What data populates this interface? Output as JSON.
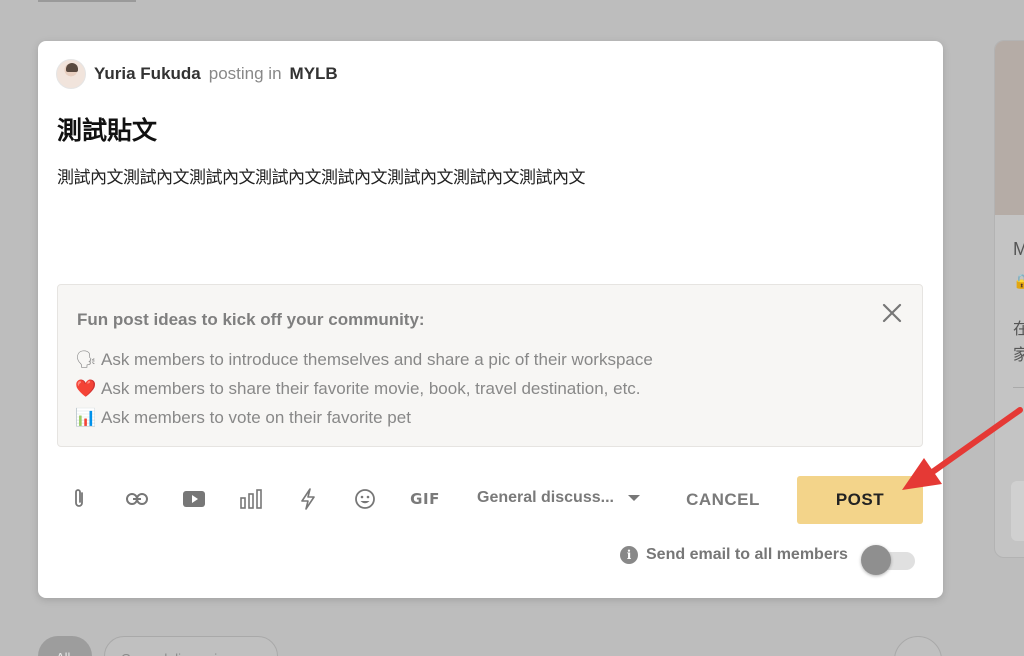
{
  "author": {
    "name": "Yuria Fukuda",
    "action": "posting in",
    "community": "MYLB"
  },
  "post": {
    "title": "測試貼文",
    "body": "測試內文測試內文測試內文測試內文測試內文測試內文測試內文測試內文"
  },
  "ideas": {
    "heading": "Fun post ideas to kick off your community:",
    "items": [
      {
        "icon": "🗣",
        "text": "Ask members to introduce themselves and share a pic of their workspace"
      },
      {
        "icon": "❤️",
        "text": "Ask members to share their favorite movie, book, travel destination, etc."
      },
      {
        "icon": "📊",
        "text": "Ask members to vote on their favorite pet"
      }
    ]
  },
  "toolbar": {
    "tools": [
      "attachment-icon",
      "link-icon",
      "video-icon",
      "poll-icon",
      "lightning-icon",
      "emoji-icon",
      "gif-icon"
    ],
    "gif_label": "GIF",
    "category": "General discuss...",
    "cancel_label": "CANCEL",
    "post_label": "POST"
  },
  "email": {
    "label": "Send email to all members",
    "enabled": false
  },
  "colors": {
    "post_button": "#f3d48a",
    "arrow": "#e53935",
    "overlay": "#bdbdbd"
  }
}
